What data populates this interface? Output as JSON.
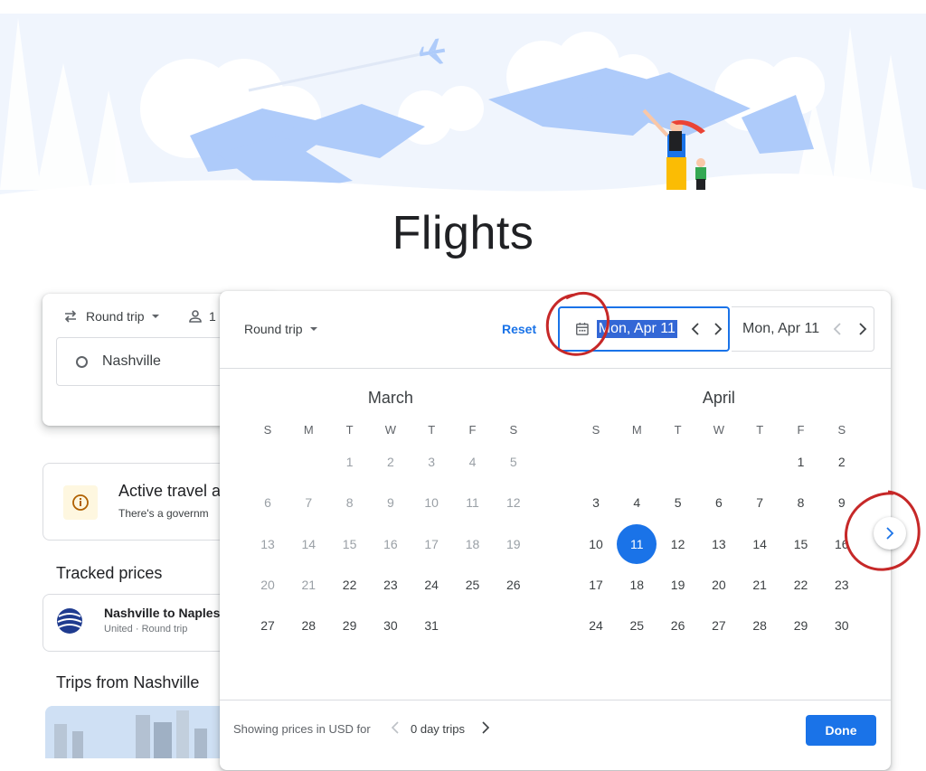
{
  "page": {
    "title": "Flights"
  },
  "search_card": {
    "trip_type": "Round trip",
    "passengers": "1",
    "origin": "Nashville"
  },
  "alert": {
    "title": "Active travel a",
    "subtitle": "There's a governm"
  },
  "tracked": {
    "heading": "Tracked prices",
    "item_title": "Nashville to Naples",
    "item_sub": "United · Round trip"
  },
  "trips": {
    "heading": "Trips from Nashville"
  },
  "date_picker": {
    "trip_type": "Round trip",
    "reset_label": "Reset",
    "departure_date": "Mon, Apr 11",
    "return_date": "Mon, Apr 11",
    "weekdays": [
      "S",
      "M",
      "T",
      "W",
      "T",
      "F",
      "S"
    ],
    "months": [
      {
        "name": "March",
        "weeks": [
          [
            "",
            "",
            "1",
            "2",
            "3",
            "4",
            "5"
          ],
          [
            "6",
            "7",
            "8",
            "9",
            "10",
            "11",
            "12"
          ],
          [
            "13",
            "14",
            "15",
            "16",
            "17",
            "18",
            "19"
          ],
          [
            "20",
            "21",
            "22",
            "23",
            "24",
            "25",
            "26"
          ],
          [
            "27",
            "28",
            "29",
            "30",
            "31",
            "",
            ""
          ]
        ],
        "past_through": 21
      },
      {
        "name": "April",
        "weeks": [
          [
            "",
            "",
            "",
            "",
            "",
            "1",
            "2"
          ],
          [
            "3",
            "4",
            "5",
            "6",
            "7",
            "8",
            "9"
          ],
          [
            "10",
            "11",
            "12",
            "13",
            "14",
            "15",
            "16"
          ],
          [
            "17",
            "18",
            "19",
            "20",
            "21",
            "22",
            "23"
          ],
          [
            "24",
            "25",
            "26",
            "27",
            "28",
            "29",
            "30"
          ]
        ],
        "past_through": 0
      }
    ],
    "selected_day": "11",
    "selected_month": "April",
    "footer": {
      "price_label": "Showing prices in USD for",
      "duration": "0 day trips",
      "done_label": "Done"
    }
  },
  "colors": {
    "accent": "#1a73e8",
    "annotation": "#c62828",
    "hero_blue": "#c6d8f5"
  }
}
